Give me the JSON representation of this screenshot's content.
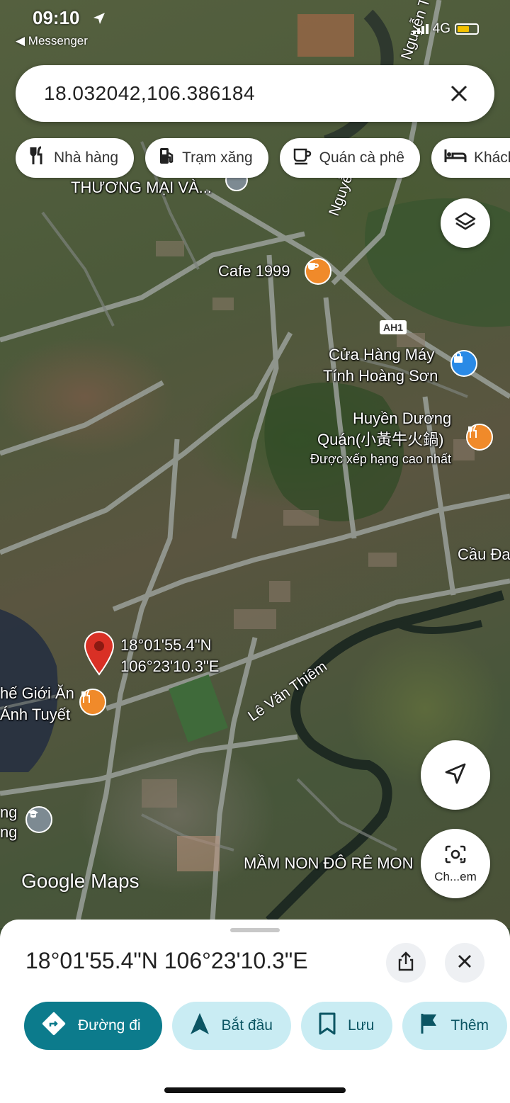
{
  "status_bar": {
    "time": "09:10",
    "back_app": "◀ Messenger",
    "network": "4G"
  },
  "search": {
    "query": "18.032042,106.386184"
  },
  "chips": [
    {
      "label": "Nhà hàng",
      "icon": "fork-knife-icon"
    },
    {
      "label": "Trạm xăng",
      "icon": "gas-station-icon"
    },
    {
      "label": "Quán cà phê",
      "icon": "coffee-icon"
    },
    {
      "label": "Khách",
      "icon": "bed-icon"
    }
  ],
  "map": {
    "labels": {
      "thuong_mai": "THƯƠNG MẠI VÀ...",
      "cafe": "Cafe 1999",
      "nguyen_trai_a": "Nguyễn Trãi",
      "nguyen_trai_b": "Nguyễn T",
      "highway": "AH1",
      "cua_hang_1": "Cửa Hàng Máy",
      "cua_hang_2": "Tính Hoàng Sơn",
      "huyen_duong_1": "Huyền Dương",
      "huyen_duong_2": "Quán(小黃牛火鍋)",
      "huyen_duong_rating": "Được xếp hạng cao nhất",
      "cau_da": "Cầu Đa",
      "pin_lat": "18°01'55.4\"N",
      "pin_lon": "106°23'10.3\"E",
      "the_gioi_1": "hế Giới Ăn",
      "the_gioi_2": "Ánh Tuyết",
      "le_van_thiem": "Lê Văn Thiêm",
      "ng_left_1": "ng",
      "ng_left_2": "ng",
      "mam_non": "MẦM NON ĐÔ RÊ MON",
      "google_maps": "Google Maps"
    }
  },
  "camera_button": {
    "label": "Ch...em"
  },
  "place_sheet": {
    "title": "18°01'55.4\"N 106°23'10.3\"E",
    "actions": [
      {
        "label": "Đường đi",
        "icon": "directions-icon"
      },
      {
        "label": "Bắt đầu",
        "icon": "navigation-arrow-icon"
      },
      {
        "label": "Lưu",
        "icon": "bookmark-icon"
      },
      {
        "label": "Thêm",
        "icon": "flag-icon"
      }
    ]
  },
  "colors": {
    "primary": "#0c7b8c",
    "secondary_bg": "#c9ecf3",
    "pin": "#d93025",
    "poi_orange": "#f08a2a",
    "poi_blue": "#2a8ae6"
  }
}
